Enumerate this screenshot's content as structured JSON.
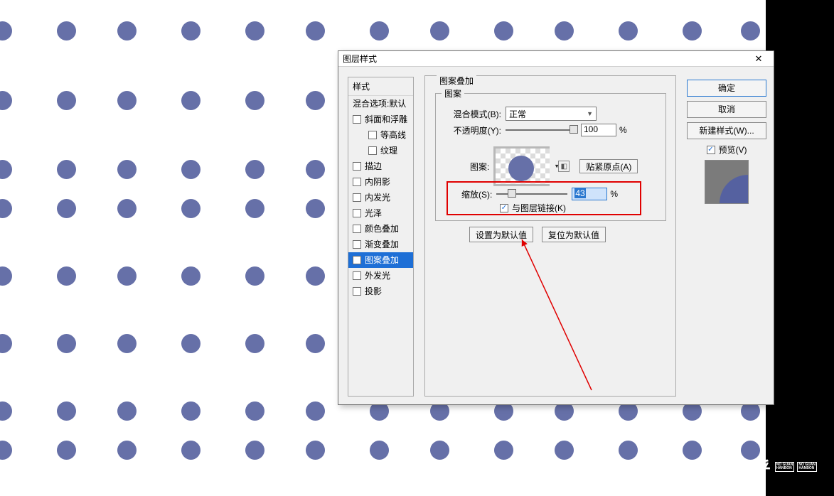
{
  "dialog": {
    "title": "图层样式",
    "styles_header": "样式",
    "blend_default": "混合选项:默认",
    "style_items": [
      {
        "label": "斜面和浮雕",
        "checked": false
      },
      {
        "label": "等高线",
        "checked": false,
        "indent": true
      },
      {
        "label": "纹理",
        "checked": false,
        "indent": true
      },
      {
        "label": "描边",
        "checked": false
      },
      {
        "label": "内阴影",
        "checked": false
      },
      {
        "label": "内发光",
        "checked": false
      },
      {
        "label": "光泽",
        "checked": false
      },
      {
        "label": "颜色叠加",
        "checked": false
      },
      {
        "label": "渐变叠加",
        "checked": false
      },
      {
        "label": "图案叠加",
        "checked": true,
        "selected": true
      },
      {
        "label": "外发光",
        "checked": false
      },
      {
        "label": "投影",
        "checked": false
      }
    ],
    "section_title": "图案叠加",
    "subsection_title": "图案",
    "blend_mode_label": "混合模式(B):",
    "blend_mode_value": "正常",
    "opacity_label": "不透明度(Y):",
    "opacity_value": "100",
    "pattern_label": "图案:",
    "snap_origin_btn": "贴紧原点(A)",
    "scale_label": "缩放(S):",
    "scale_value": "43",
    "link_layer_label": "与图层链接(K)",
    "set_default_btn": "设置为默认值",
    "reset_default_btn": "复位为默认值",
    "ok_btn": "确定",
    "cancel_btn": "取消",
    "new_style_btn": "新建样式(W)...",
    "preview_label": "预览(V)"
  },
  "watermark": "知乎"
}
